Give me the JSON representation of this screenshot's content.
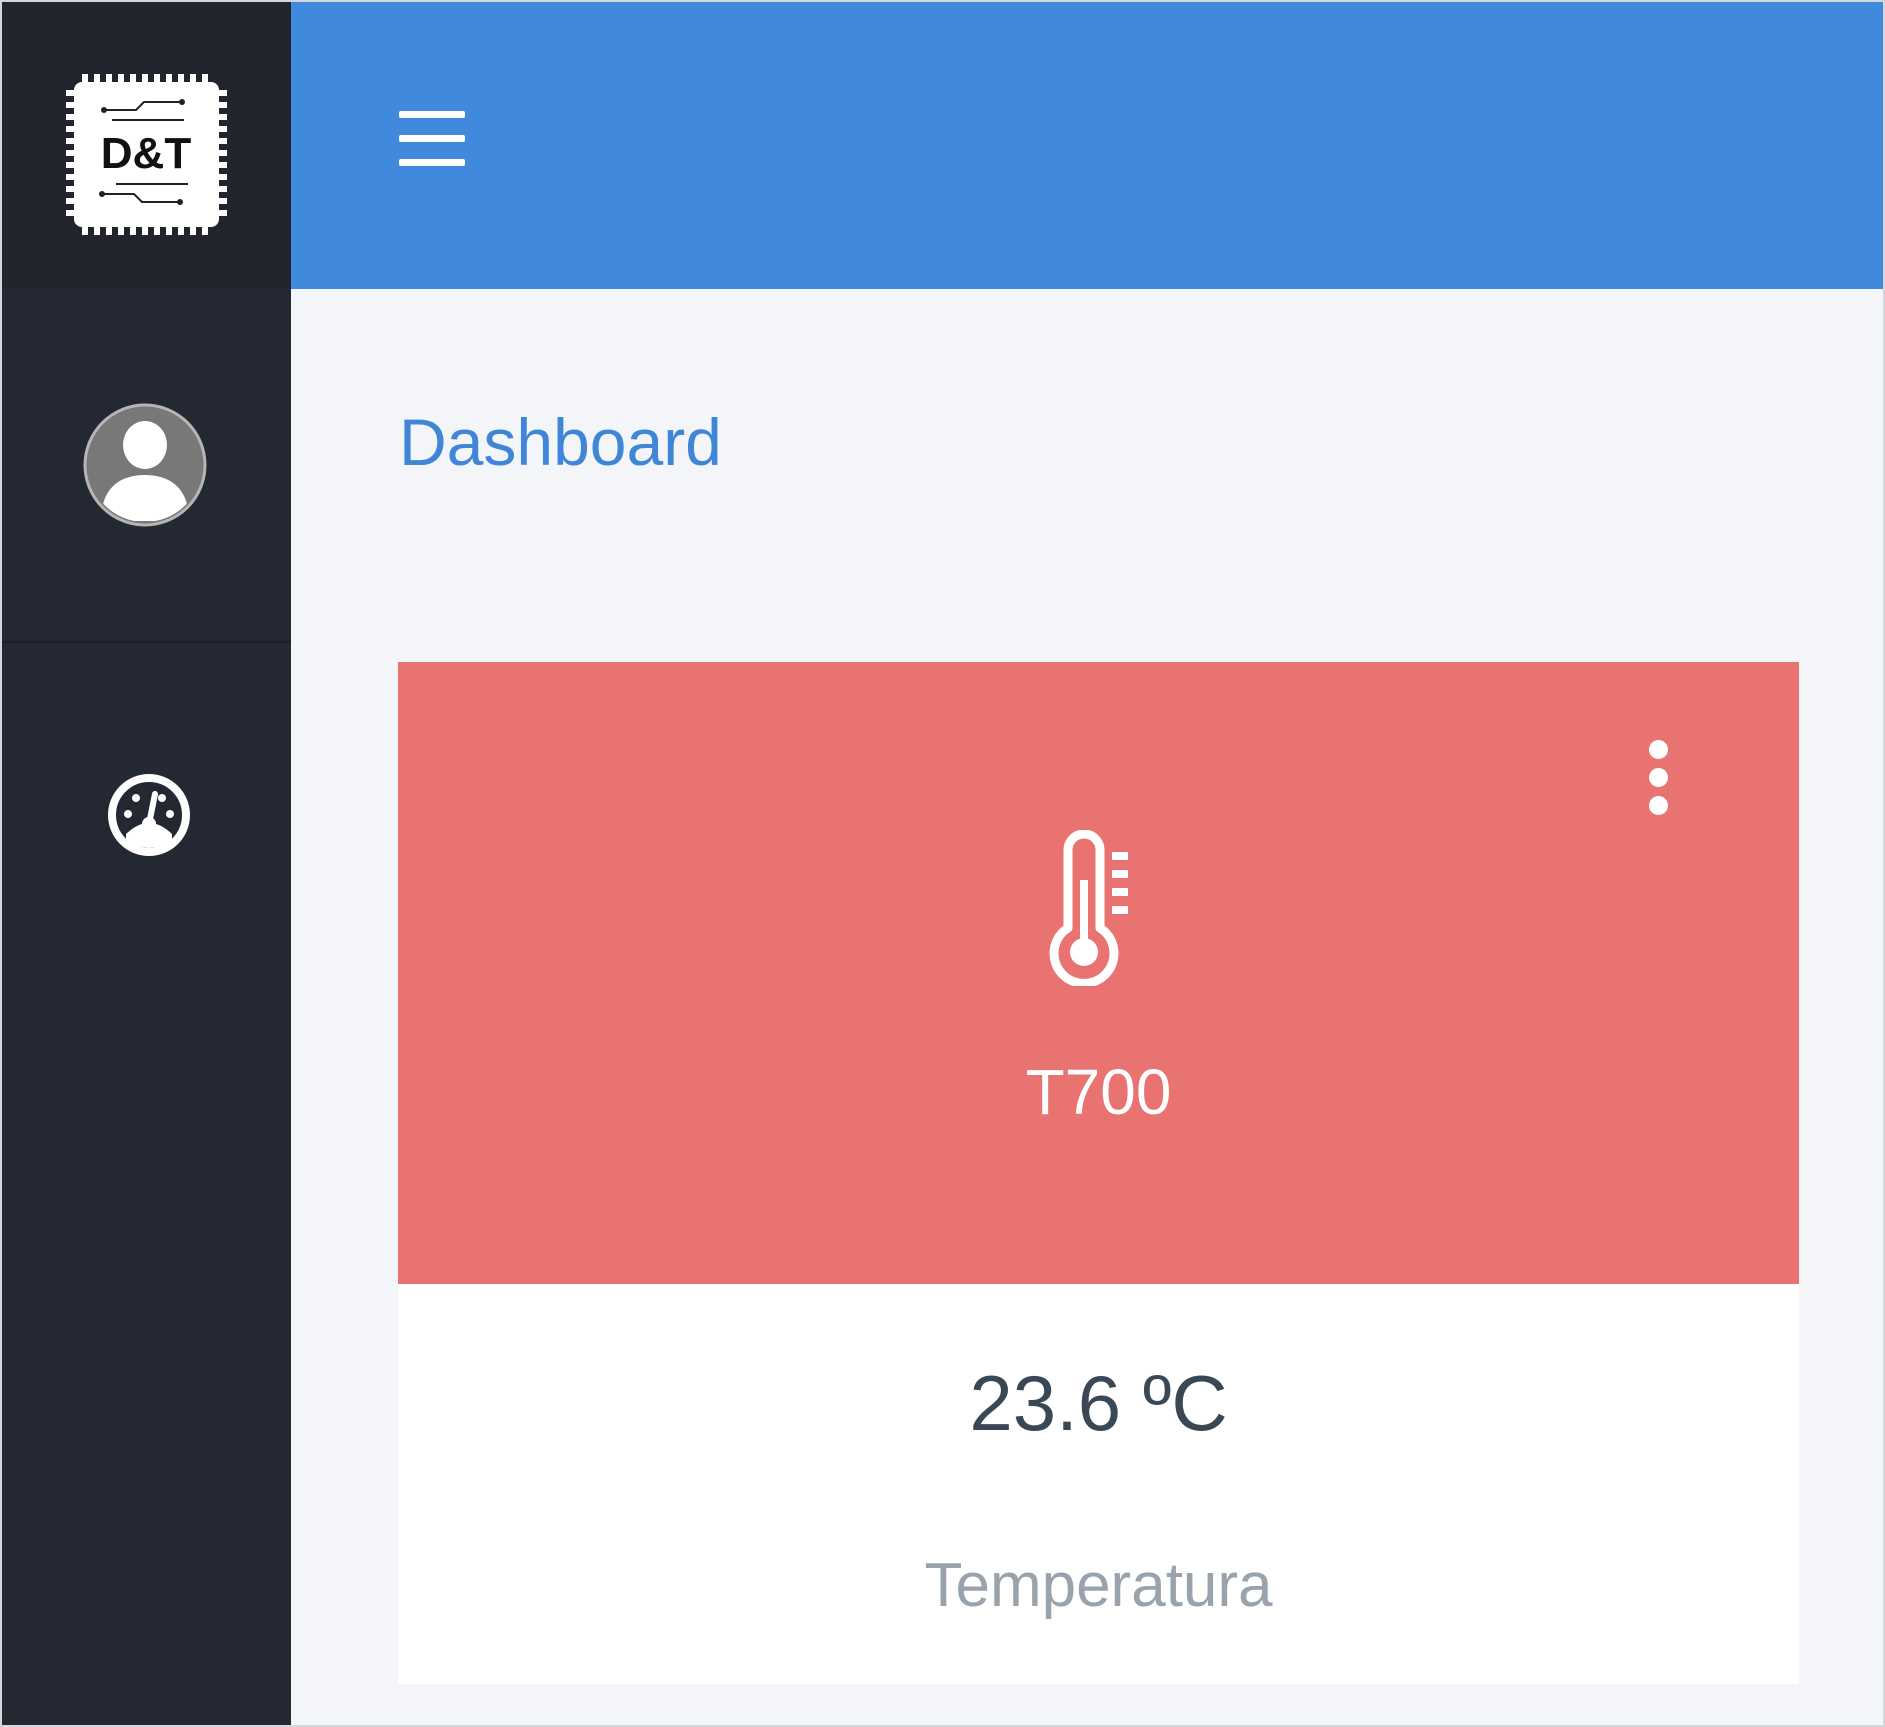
{
  "sidebar": {
    "logo_text": "D&T",
    "logo_icon": "chip-logo",
    "avatar_icon": "user-avatar-icon",
    "nav_items": [
      {
        "icon": "dashboard-gauge-icon"
      }
    ]
  },
  "header": {
    "menu_icon": "hamburger-menu-icon"
  },
  "main": {
    "title": "Dashboard",
    "cards": [
      {
        "icon": "thermometer-icon",
        "menu_icon": "more-vertical-icon",
        "name": "T700",
        "value": "23.6 ºC",
        "type": "Temperatura",
        "color": "#e97370"
      }
    ]
  },
  "colors": {
    "sidebar": "#242832",
    "topbar": "#4189dd",
    "accent_text": "#3f86d8",
    "background": "#f4f5f9"
  }
}
